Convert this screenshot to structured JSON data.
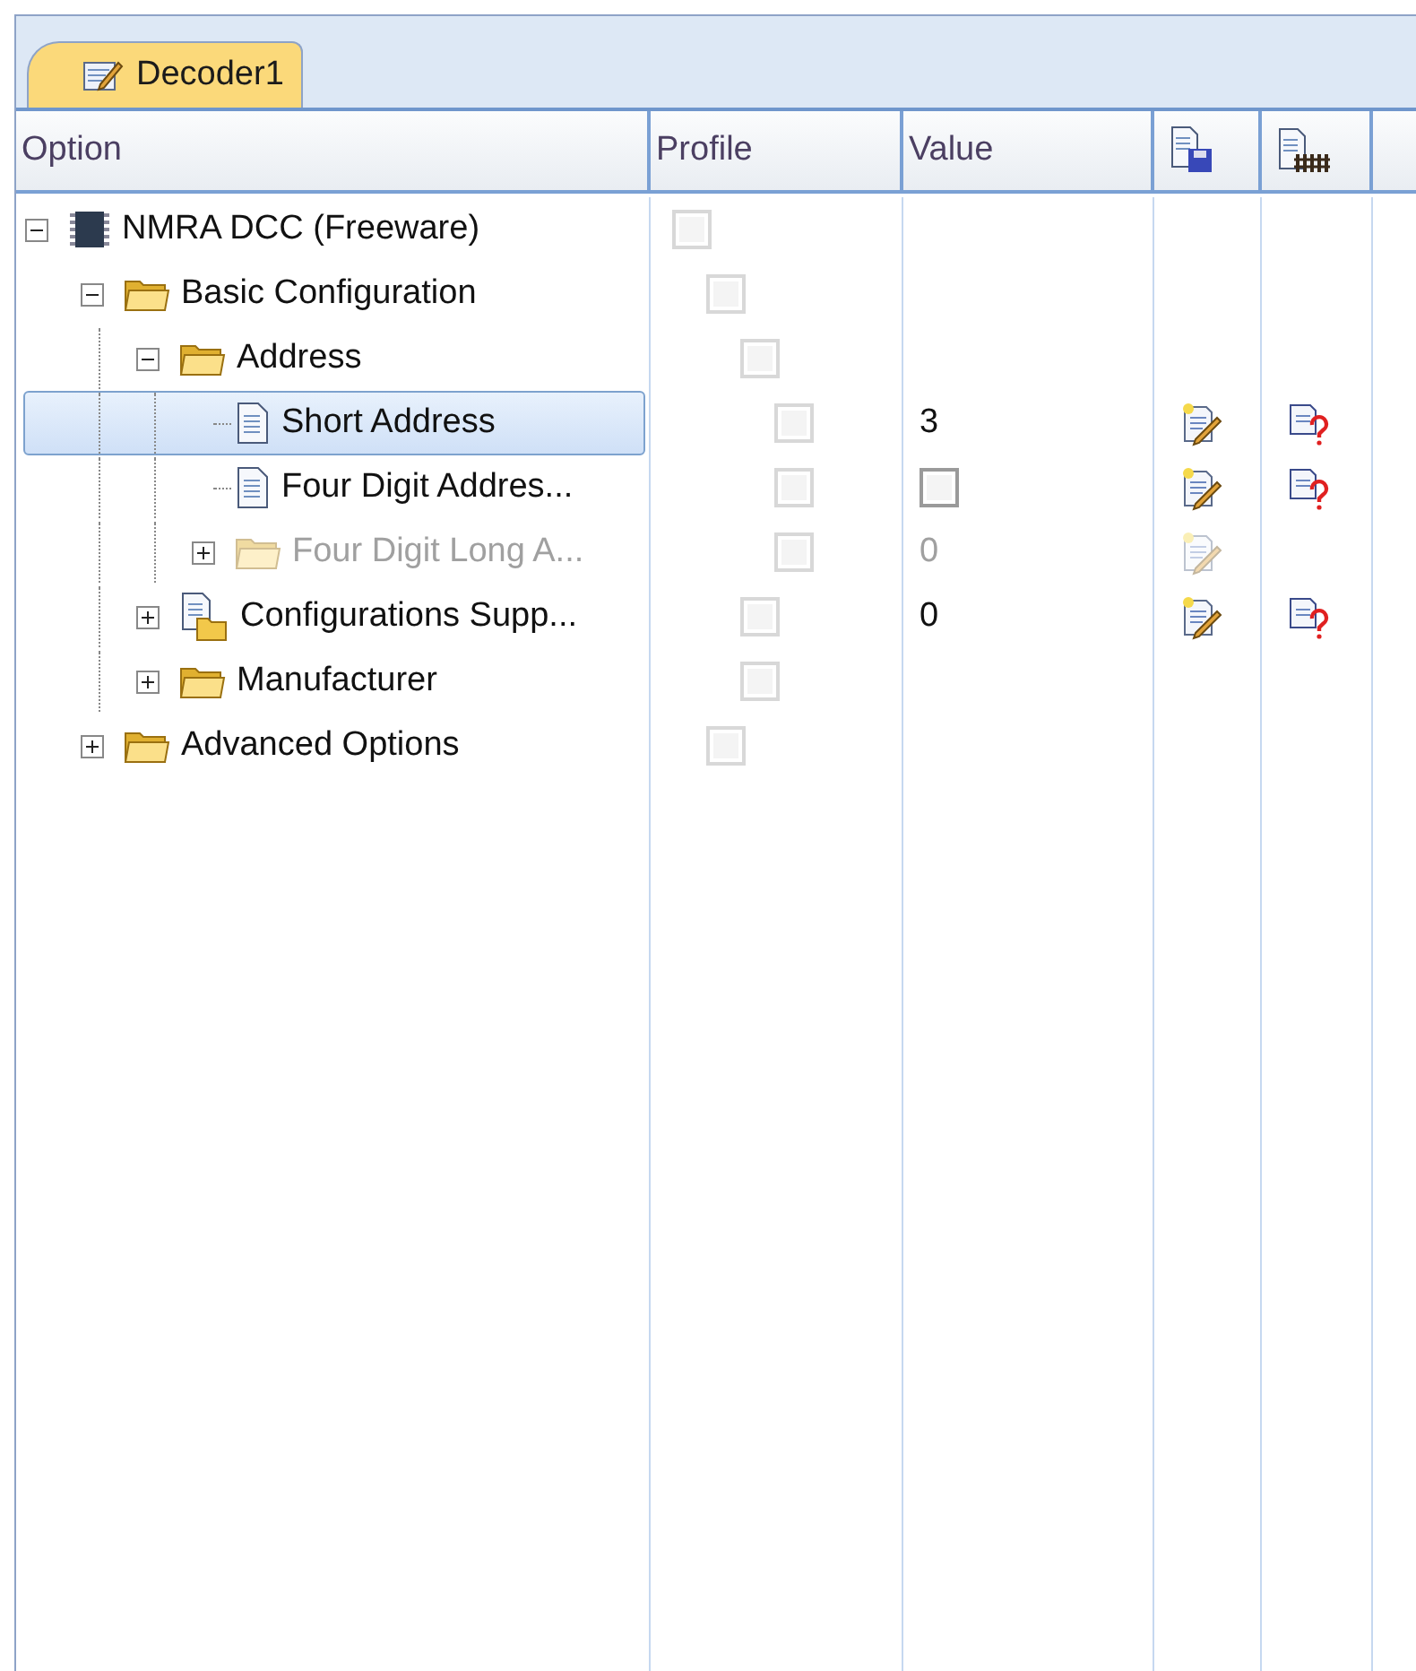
{
  "tabs": [
    {
      "label": "Decoder1",
      "selected": true
    }
  ],
  "columns": [
    {
      "kind": "text",
      "label": "Option"
    },
    {
      "kind": "text",
      "label": "Profile"
    },
    {
      "kind": "text",
      "label": "Value"
    },
    {
      "kind": "save"
    },
    {
      "kind": "fence"
    }
  ],
  "tree": [
    {
      "label": "NMRA DCC (Freeware)",
      "kind": "chip",
      "expanded": true,
      "selected": false,
      "disabled": false,
      "profile_checked": false,
      "children": [
        {
          "label": "Basic Configuration",
          "kind": "folder",
          "expanded": true,
          "selected": false,
          "disabled": false,
          "profile_checked": false,
          "children": [
            {
              "label": "Address",
              "kind": "folder",
              "expanded": true,
              "selected": false,
              "disabled": false,
              "profile_checked": false,
              "children": [
                {
                  "label": "Short Address",
                  "kind": "document",
                  "selected": true,
                  "disabled": false,
                  "profile_checked": false,
                  "value": {
                    "kind": "text",
                    "text": "3"
                  },
                  "edit": true,
                  "help": true
                },
                {
                  "label": "Four Digit Addres...",
                  "kind": "document",
                  "selected": false,
                  "disabled": false,
                  "profile_checked": false,
                  "value": {
                    "kind": "checkbox",
                    "checked": false
                  },
                  "edit": true,
                  "help": true
                },
                {
                  "label": "Four Digit Long A...",
                  "kind": "folder",
                  "expanded": false,
                  "selected": false,
                  "disabled": true,
                  "profile_checked": false,
                  "value": {
                    "kind": "text",
                    "text": "0"
                  },
                  "edit": true,
                  "help": false
                }
              ]
            },
            {
              "label": "Configurations Supp...",
              "kind": "doc-folder",
              "expanded": false,
              "selected": false,
              "disabled": false,
              "profile_checked": false,
              "value": {
                "kind": "text",
                "text": "0"
              },
              "edit": true,
              "help": true
            },
            {
              "label": "Manufacturer",
              "kind": "folder",
              "expanded": false,
              "selected": false,
              "disabled": false,
              "profile_checked": false
            }
          ]
        },
        {
          "label": "Advanced Options",
          "kind": "folder",
          "expanded": false,
          "selected": false,
          "disabled": false,
          "profile_checked": false
        }
      ]
    }
  ]
}
